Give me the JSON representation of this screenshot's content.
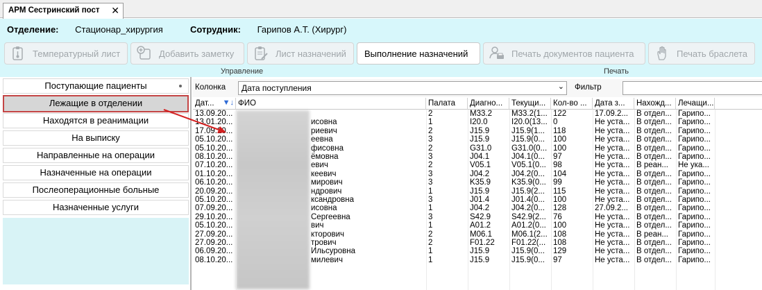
{
  "tab": {
    "title": "АРМ Сестринский пост",
    "close": "✕"
  },
  "info": {
    "department_label": "Отделение:",
    "department_value": "Стационар_хирургия",
    "employee_label": "Сотрудник:",
    "employee_value": "Гарипов А.Т. (Хирург)"
  },
  "toolbar": {
    "temp_sheet": "Температурный лист",
    "add_note": "Добавить заметку",
    "prescriptions": "Лист назначений",
    "execution": "Выполнение назначений",
    "print_docs": "Печать документов пациента",
    "print_bracelet": "Печать браслета",
    "group_manage": "Управление",
    "group_print": "Печать"
  },
  "menu": {
    "items": [
      "Поступающие пациенты",
      "Лежащие в отделении",
      "Находятся в реанимации",
      "На выписку",
      "Направленные на операции",
      "Назначенные на операции",
      "Послеоперационные больные",
      "Назначенные услуги"
    ]
  },
  "filterbar": {
    "column_label": "Колонка",
    "column_value": "Дата поступления",
    "filter_label": "Фильтр",
    "dropdown_arrow": "⌄"
  },
  "grid": {
    "headers": [
      "Дат...",
      "ФИО",
      "Палата",
      "Диагно...",
      "Текущи...",
      "Кол-во ...",
      "Дата з...",
      "Нахожд...",
      "Лечащи..."
    ],
    "sort_icon": "sort-desc-icon",
    "rows": [
      [
        "13.09.20...",
        "",
        "2",
        "M33.2",
        "M33.2(1...",
        "122",
        "17.09.2...",
        "В отдел...",
        "Гарипо..."
      ],
      [
        "13.01.20...",
        "исовна",
        "1",
        "I20.0",
        "I20.0(13...",
        "0",
        "Не уста...",
        "В отдел...",
        "Гарипо..."
      ],
      [
        "17.09.20...",
        "риевич",
        "2",
        "J15.9",
        "J15.9(1...",
        "118",
        "Не уста...",
        "В отдел...",
        "Гарипо..."
      ],
      [
        "05.10.20...",
        "еевна",
        "3",
        "J15.9",
        "J15.9(0...",
        "100",
        "Не уста...",
        "В отдел...",
        "Гарипо..."
      ],
      [
        "05.10.20...",
        "фисовна",
        "2",
        "G31.0",
        "G31.0(0...",
        "100",
        "Не уста...",
        "В отдел...",
        "Гарипо..."
      ],
      [
        "08.10.20...",
        "ёмовна",
        "3",
        "J04.1",
        "J04.1(0...",
        "97",
        "Не уста...",
        "В отдел...",
        "Гарипо..."
      ],
      [
        "07.10.20...",
        "евич",
        "2",
        "V05.1",
        "V05.1(0...",
        "98",
        "Не уста...",
        "В реан...",
        "Не ука..."
      ],
      [
        "01.10.20...",
        "кеевич",
        "3",
        "J04.2",
        "J04.2(0...",
        "104",
        "Не уста...",
        "В отдел...",
        "Гарипо..."
      ],
      [
        "06.10.20...",
        "мирович",
        "3",
        "K35.9",
        "K35.9(0...",
        "99",
        "Не уста...",
        "В отдел...",
        "Гарипо..."
      ],
      [
        "20.09.20...",
        "ндрович",
        "1",
        "J15.9",
        "J15.9(2...",
        "115",
        "Не уста...",
        "В отдел...",
        "Гарипо..."
      ],
      [
        "05.10.20...",
        "ксандровна",
        "3",
        "J01.4",
        "J01.4(0...",
        "100",
        "Не уста...",
        "В отдел...",
        "Гарипо..."
      ],
      [
        "07.09.20...",
        "исовна",
        "1",
        "J04.2",
        "J04.2(0...",
        "128",
        "27.09.2...",
        "В отдел...",
        "Гарипо..."
      ],
      [
        "29.10.20...",
        "Сергеевна",
        "3",
        "S42.9",
        "S42.9(2...",
        "76",
        "Не уста...",
        "В отдел...",
        "Гарипо..."
      ],
      [
        "05.10.20...",
        "вич",
        "1",
        "A01.2",
        "A01.2(0...",
        "100",
        "Не уста...",
        "В отдел...",
        "Гарипо..."
      ],
      [
        "27.09.20...",
        "кторович",
        "2",
        "M06.1",
        "M06.1(2...",
        "108",
        "Не уста...",
        "В реан...",
        "Гарипо..."
      ],
      [
        "27.09.20...",
        "трович",
        "2",
        "F01.22",
        "F01.22(...",
        "108",
        "Не уста...",
        "В отдел...",
        "Гарипо..."
      ],
      [
        "06.09.20...",
        "Ильсуровна",
        "1",
        "J15.9",
        "J15.9(0...",
        "129",
        "Не уста...",
        "В отдел...",
        "Гарипо..."
      ],
      [
        "08.10.20...",
        "милевич",
        "1",
        "J15.9",
        "J15.9(0...",
        "97",
        "Не уста...",
        "В отдел...",
        "Гарипо..."
      ]
    ]
  },
  "colors": {
    "panel": "#d7f7fb",
    "selected_border": "#c44545",
    "arrow": "#d42020"
  }
}
